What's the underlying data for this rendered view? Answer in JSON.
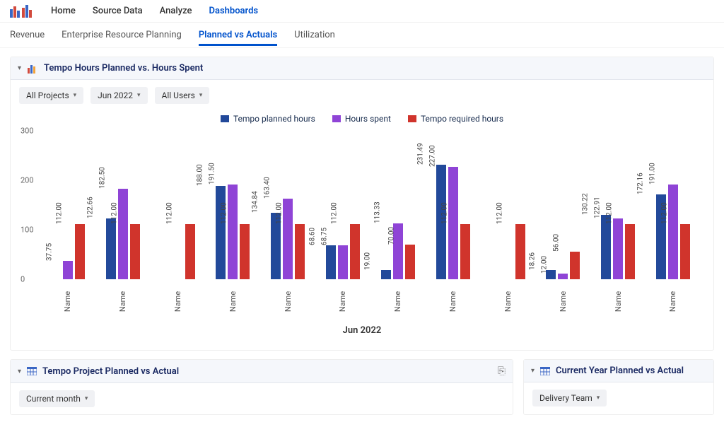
{
  "colors": {
    "planned": "#22499a",
    "spent": "#8f44d6",
    "required": "#d0342c"
  },
  "topnav": {
    "items": [
      "Home",
      "Source Data",
      "Analyze",
      "Dashboards"
    ],
    "active_index": 3
  },
  "subtabs": {
    "items": [
      "Revenue",
      "Enterprise Resource Planning",
      "Planned vs Actuals",
      "Utilization"
    ],
    "active_index": 2
  },
  "panel_main": {
    "title": "Tempo Hours Planned vs. Hours Spent",
    "filters": {
      "projects": "All Projects",
      "period": "Jun 2022",
      "users": "All Users"
    },
    "legend": {
      "planned": "Tempo planned hours",
      "spent": "Hours spent",
      "required": "Tempo required hours"
    },
    "period_label": "Jun 2022"
  },
  "panel_left": {
    "title": "Tempo Project Planned vs Actual",
    "filter": "Current month"
  },
  "panel_right": {
    "title": "Current Year Planned vs Actual",
    "filter": "Delivery Team"
  },
  "chart_data": {
    "type": "bar",
    "ylabel": "",
    "xlabel": "",
    "ylim": [
      0,
      300
    ],
    "yticks": [
      0,
      100,
      200,
      300
    ],
    "categories": [
      "Name",
      "Name",
      "Name",
      "Name",
      "Name",
      "Name",
      "Name",
      "Name",
      "Name",
      "Name",
      "Name",
      "Name"
    ],
    "series": [
      {
        "name": "Tempo planned hours",
        "key": "planned",
        "values": [
          null,
          122.66,
          null,
          188.0,
          134.84,
          68.6,
          19.0,
          231.0,
          null,
          18.26,
          130.22,
          172.16
        ]
      },
      {
        "name": "Hours spent",
        "key": "spent",
        "values": [
          37.75,
          182.5,
          null,
          191.5,
          163.4,
          68.75,
          113.33,
          227.0,
          null,
          12.0,
          122.91,
          191.0
        ]
      },
      {
        "name": "Tempo required hours",
        "key": "required",
        "values": [
          112.0,
          112.0,
          112.0,
          112.0,
          112.0,
          112.0,
          70.0,
          112.0,
          112.0,
          56.0,
          112.0,
          112.0
        ]
      }
    ],
    "value_labels": [
      {
        "planned": "",
        "spent": "37.75",
        "required": "112.00"
      },
      {
        "planned": "122.66",
        "spent": "182.50",
        "required": "112.00"
      },
      {
        "planned": "",
        "spent": "",
        "required": "112.00"
      },
      {
        "planned": "188.00",
        "spent": "191.50",
        "required": "112.00"
      },
      {
        "planned": "134.84",
        "spent": "163.40",
        "required": "112.00"
      },
      {
        "planned": "68.60",
        "spent": "68.75",
        "required": "112.00"
      },
      {
        "planned": "19.00",
        "spent": "113.33",
        "required": "70.00"
      },
      {
        "planned": "231.49",
        "spent": "227.00",
        "required": "112.00"
      },
      {
        "planned": "",
        "spent": "",
        "required": "112.00"
      },
      {
        "planned": "18.26",
        "spent": "12.00",
        "required": "56.00"
      },
      {
        "planned": "130.22",
        "spent": "122.91",
        "required": "112.00"
      },
      {
        "planned": "172.16",
        "spent": "191.00",
        "required": "112.00"
      }
    ]
  }
}
